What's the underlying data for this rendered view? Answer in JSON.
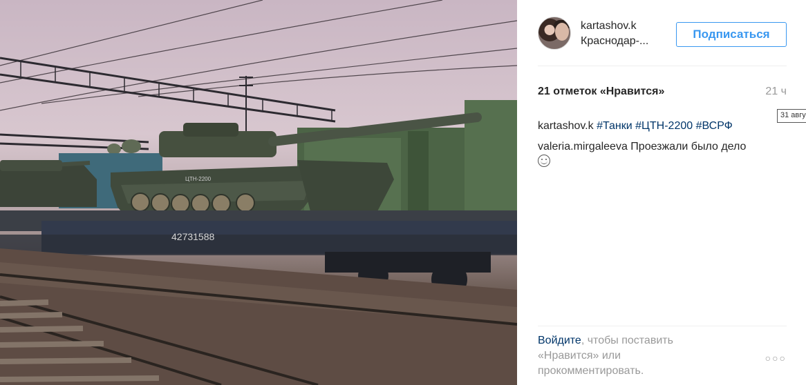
{
  "post": {
    "username": "kartashov.k",
    "location": "Краснодар-...",
    "follow_label": "Подписаться",
    "likes": "21 отметок «Нравится»",
    "time": "21 ч",
    "tooltip": "31 авгу",
    "caption": {
      "user": "kartashov.k",
      "tags": [
        "#Танки",
        "#ЦТН-2200",
        "#ВСРФ"
      ]
    },
    "comment": {
      "user": "valeria.mirgaleeva",
      "text": "Проезжали было дело"
    },
    "login_link": "Войдите",
    "login_rest": ", чтобы поставить «Нравится» или прокомментировать.",
    "more_icon": "ellipsis-icon"
  },
  "photo": {
    "icon": "photo-image",
    "markings": {
      "tank_number": "ЦТН-2200",
      "wagon_number": "42731588"
    }
  }
}
